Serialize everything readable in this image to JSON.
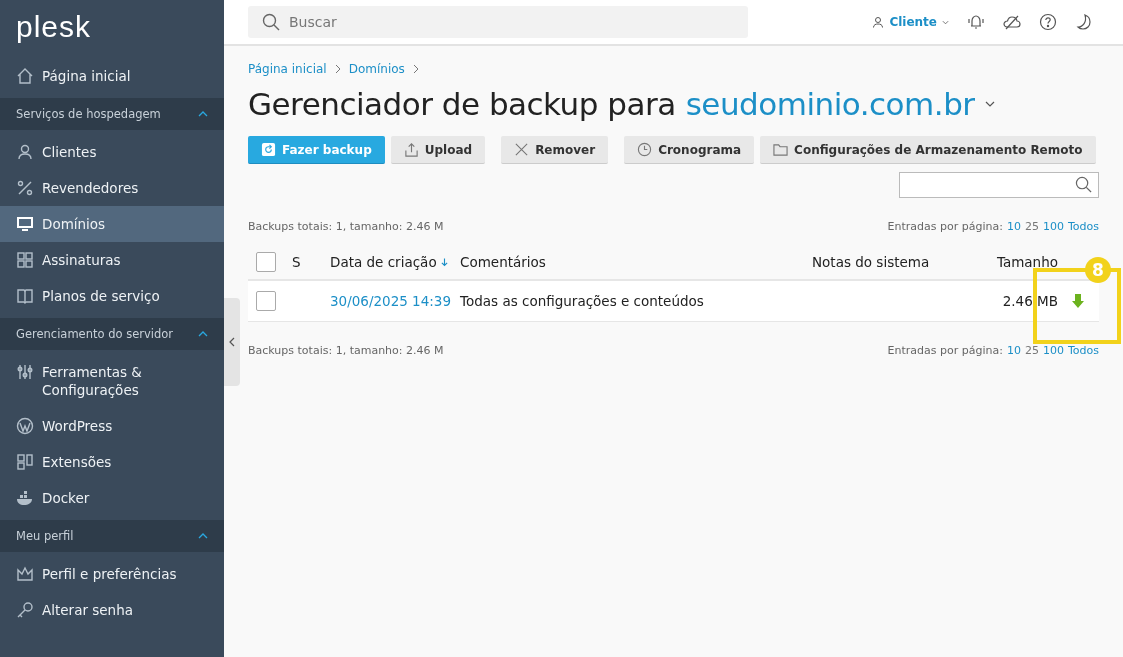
{
  "sidebar": {
    "logo": "plesk",
    "entries": [
      {
        "kind": "item",
        "label": "Página inicial",
        "selected": false
      },
      {
        "kind": "section",
        "label": "Serviços de hospedagem",
        "expanded": true
      },
      {
        "kind": "item",
        "label": "Clientes",
        "selected": false
      },
      {
        "kind": "item",
        "label": "Revendedores",
        "selected": false
      },
      {
        "kind": "item",
        "label": "Domínios",
        "selected": true
      },
      {
        "kind": "item",
        "label": "Assinaturas",
        "selected": false
      },
      {
        "kind": "item",
        "label": "Planos de serviço",
        "selected": false
      },
      {
        "kind": "section",
        "label": "Gerenciamento do servidor",
        "expanded": true
      },
      {
        "kind": "item",
        "label": "Ferramentas & Configurações",
        "selected": false
      },
      {
        "kind": "item",
        "label": "WordPress",
        "selected": false
      },
      {
        "kind": "item",
        "label": "Extensões",
        "selected": false
      },
      {
        "kind": "item",
        "label": "Docker",
        "selected": false
      },
      {
        "kind": "section",
        "label": "Meu perfil",
        "expanded": true
      },
      {
        "kind": "item",
        "label": "Perfil e preferências",
        "selected": false
      },
      {
        "kind": "item",
        "label": "Alterar senha",
        "selected": false
      }
    ]
  },
  "topbar": {
    "search": {
      "placeholder": "Buscar"
    },
    "user": "Cliente"
  },
  "breadcrumbs": [
    "Página inicial",
    "Domínios"
  ],
  "title": {
    "text": "Gerenciador de backup para",
    "domain": "seudominio.com.br"
  },
  "buttons": [
    {
      "label": "Fazer backup",
      "kind": "primary"
    },
    {
      "label": "Upload",
      "kind": "default"
    },
    {
      "label": "Remover",
      "kind": "default"
    },
    {
      "label": "Cronograma",
      "kind": "default"
    },
    {
      "label": "Configurações de Armazenamento Remoto",
      "kind": "default"
    }
  ],
  "summary_top": "Backups totais: 1, tamanho: 2.46 M",
  "per_page_top": {
    "label": "Entradas por página:",
    "options": [
      {
        "label": "10",
        "selected": false
      },
      {
        "label": "25",
        "selected": true
      },
      {
        "label": "100",
        "selected": false
      },
      {
        "label": "Todos",
        "selected": false
      }
    ]
  },
  "table": {
    "select_all": {
      "checked": false
    },
    "columns": [
      {
        "label": "S",
        "sorted": false
      },
      {
        "label": "Data de criação",
        "sorted": true
      },
      {
        "label": "Comentários",
        "sorted": false
      },
      {
        "label": "Notas do sistema",
        "sorted": false
      },
      {
        "label": "Tamanho",
        "sorted": false
      }
    ],
    "rows": [
      {
        "checked": false,
        "date": "30/06/2025 14:39",
        "comment": "Todas as configurações e conteúdos",
        "size": "2.46 MB"
      }
    ]
  },
  "summary_bottom": "Backups totais: 1, tamanho: 2.46 M",
  "per_page_bottom": {
    "label": "Entradas por página:",
    "options": [
      {
        "label": "10",
        "selected": false
      },
      {
        "label": "25",
        "selected": true
      },
      {
        "label": "100",
        "selected": false
      },
      {
        "label": "Todos",
        "selected": false
      }
    ]
  },
  "callout": {
    "badge": "8"
  }
}
